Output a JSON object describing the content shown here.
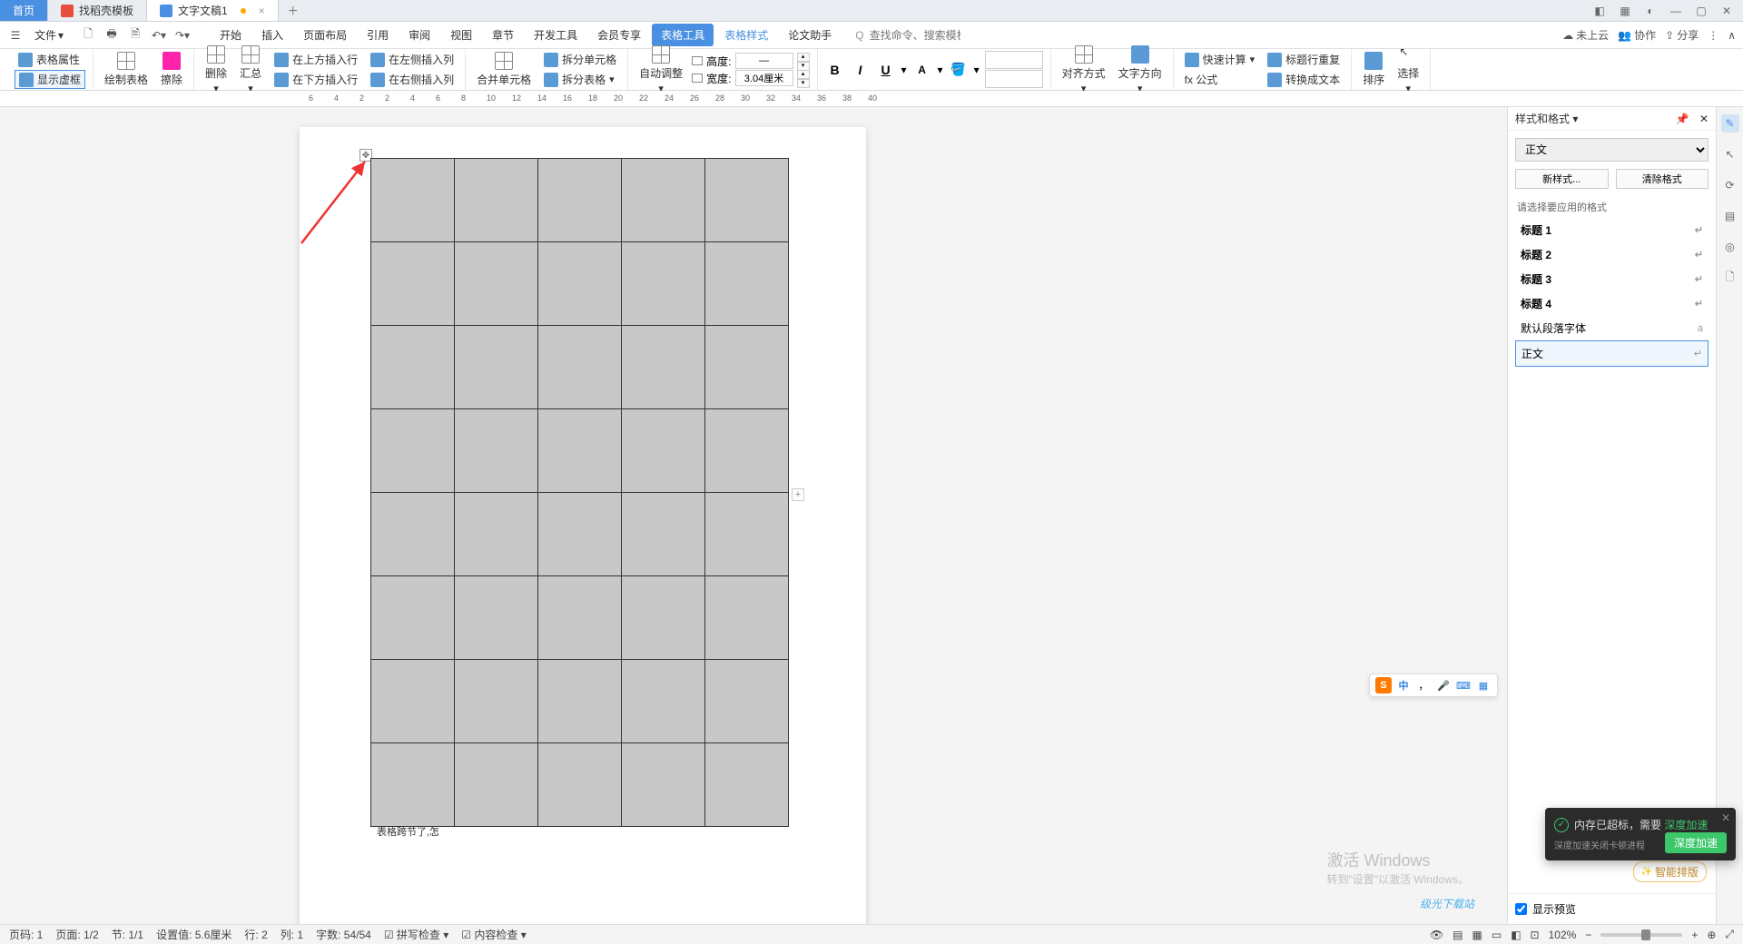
{
  "tabs": {
    "home": "首页",
    "t1": "找稻壳模板",
    "t2": "文字文稿1"
  },
  "menu": {
    "file": "文件",
    "items": [
      "开始",
      "插入",
      "页面布局",
      "引用",
      "审阅",
      "视图",
      "章节",
      "开发工具",
      "会员专享",
      "表格工具",
      "表格样式",
      "论文助手"
    ],
    "search_icon": "Q",
    "search_placeholder": "查找命令、搜索模板",
    "right": {
      "cloud": "未上云",
      "coop": "协作",
      "share": "分享"
    }
  },
  "ribbon": {
    "table_props": "表格属性",
    "show_borders": "显示虚框",
    "draw_table": "绘制表格",
    "eraser": "擦除",
    "delete": "删除",
    "summary": "汇总",
    "ins_above": "在上方插入行",
    "ins_below": "在下方插入行",
    "ins_left": "在左侧插入列",
    "ins_right": "在右侧插入列",
    "merge": "合并单元格",
    "split_cell": "拆分单元格",
    "split_table": "拆分表格",
    "autofit": "自动调整",
    "height_label": "高度:",
    "height_value": "—",
    "width_label": "宽度:",
    "width_value": "3.04厘米",
    "align": "对齐方式",
    "text_dir": "文字方向",
    "fast_calc": "快速计算",
    "formula": "fx 公式",
    "header_repeat": "标题行重复",
    "to_text": "转换成文本",
    "sort": "排序",
    "select": "选择"
  },
  "ruler_marks": [
    "6",
    "4",
    "2",
    "2",
    "4",
    "6",
    "8",
    "10",
    "12",
    "14",
    "16",
    "18",
    "20",
    "22",
    "24",
    "26",
    "28",
    "30",
    "32",
    "34",
    "36",
    "38",
    "40"
  ],
  "page": {
    "footer_text": "表格跨节了,怎"
  },
  "styles_panel": {
    "title": "样式和格式",
    "current": "正文",
    "new": "新样式...",
    "clear": "清除格式",
    "prompt": "请选择要应用的格式",
    "list": [
      "标题 1",
      "标题 2",
      "标题 3",
      "标题 4"
    ],
    "default_font": "默认段落字体",
    "body": "正文",
    "show_preview": "显示预览"
  },
  "status": {
    "page_no": "页码: 1",
    "page": "页面: 1/2",
    "section": "节: 1/1",
    "pos": "设置值: 5.6厘米",
    "row": "行: 2",
    "col": "列: 1",
    "words": "字数: 54/54",
    "spell": "拼写检查",
    "content": "内容检查",
    "zoom": "102%"
  },
  "ime": {
    "logo": "S",
    "lang": "中"
  },
  "toast": {
    "line1a": "内存已超标，需要",
    "line1b": "深度加速",
    "line2": "深度加速关闭卡顿进程",
    "btn": "深度加速"
  },
  "activate": {
    "l1": "激活 Windows",
    "l2": "转到\"设置\"以激活 Windows。"
  },
  "ai_badge": "智能排版",
  "watermark": "级光下载站"
}
